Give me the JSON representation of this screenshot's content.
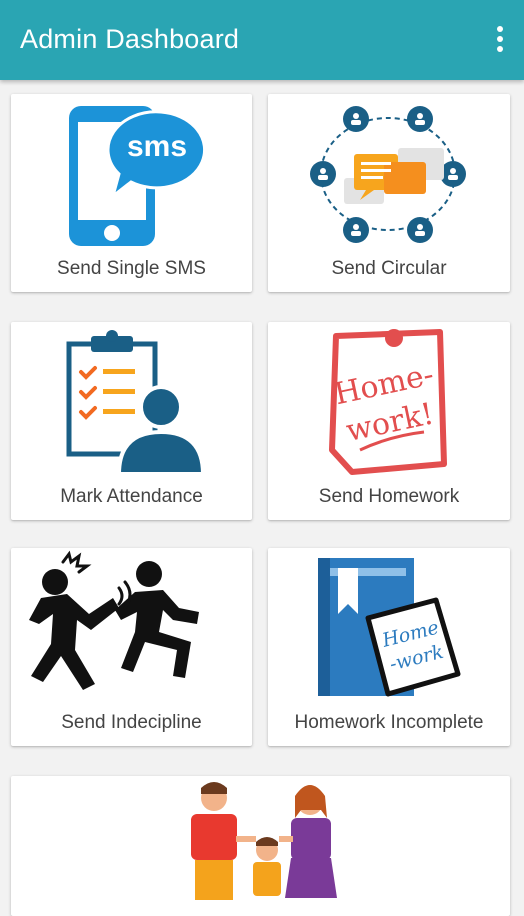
{
  "appbar": {
    "title": "Admin Dashboard",
    "menu_icon": "more-vert-icon",
    "background": "#2aa5b3"
  },
  "tiles": [
    {
      "label": "Send Single SMS",
      "icon": "sms-phone-icon",
      "icon_text": "sms"
    },
    {
      "label": "Send Circular",
      "icon": "circular-network-icon"
    },
    {
      "label": "Mark Attendance",
      "icon": "attendance-clipboard-icon"
    },
    {
      "label": "Send Homework",
      "icon": "homework-note-icon",
      "icon_text": [
        "Home-",
        "work!"
      ]
    },
    {
      "label": "Send Indecipline",
      "icon": "indiscipline-fight-icon"
    },
    {
      "label": "Homework Incomplete",
      "icon": "homework-incomplete-icon",
      "icon_text": [
        "Home",
        "-work"
      ]
    },
    {
      "label": "",
      "icon": "family-icon"
    }
  ]
}
